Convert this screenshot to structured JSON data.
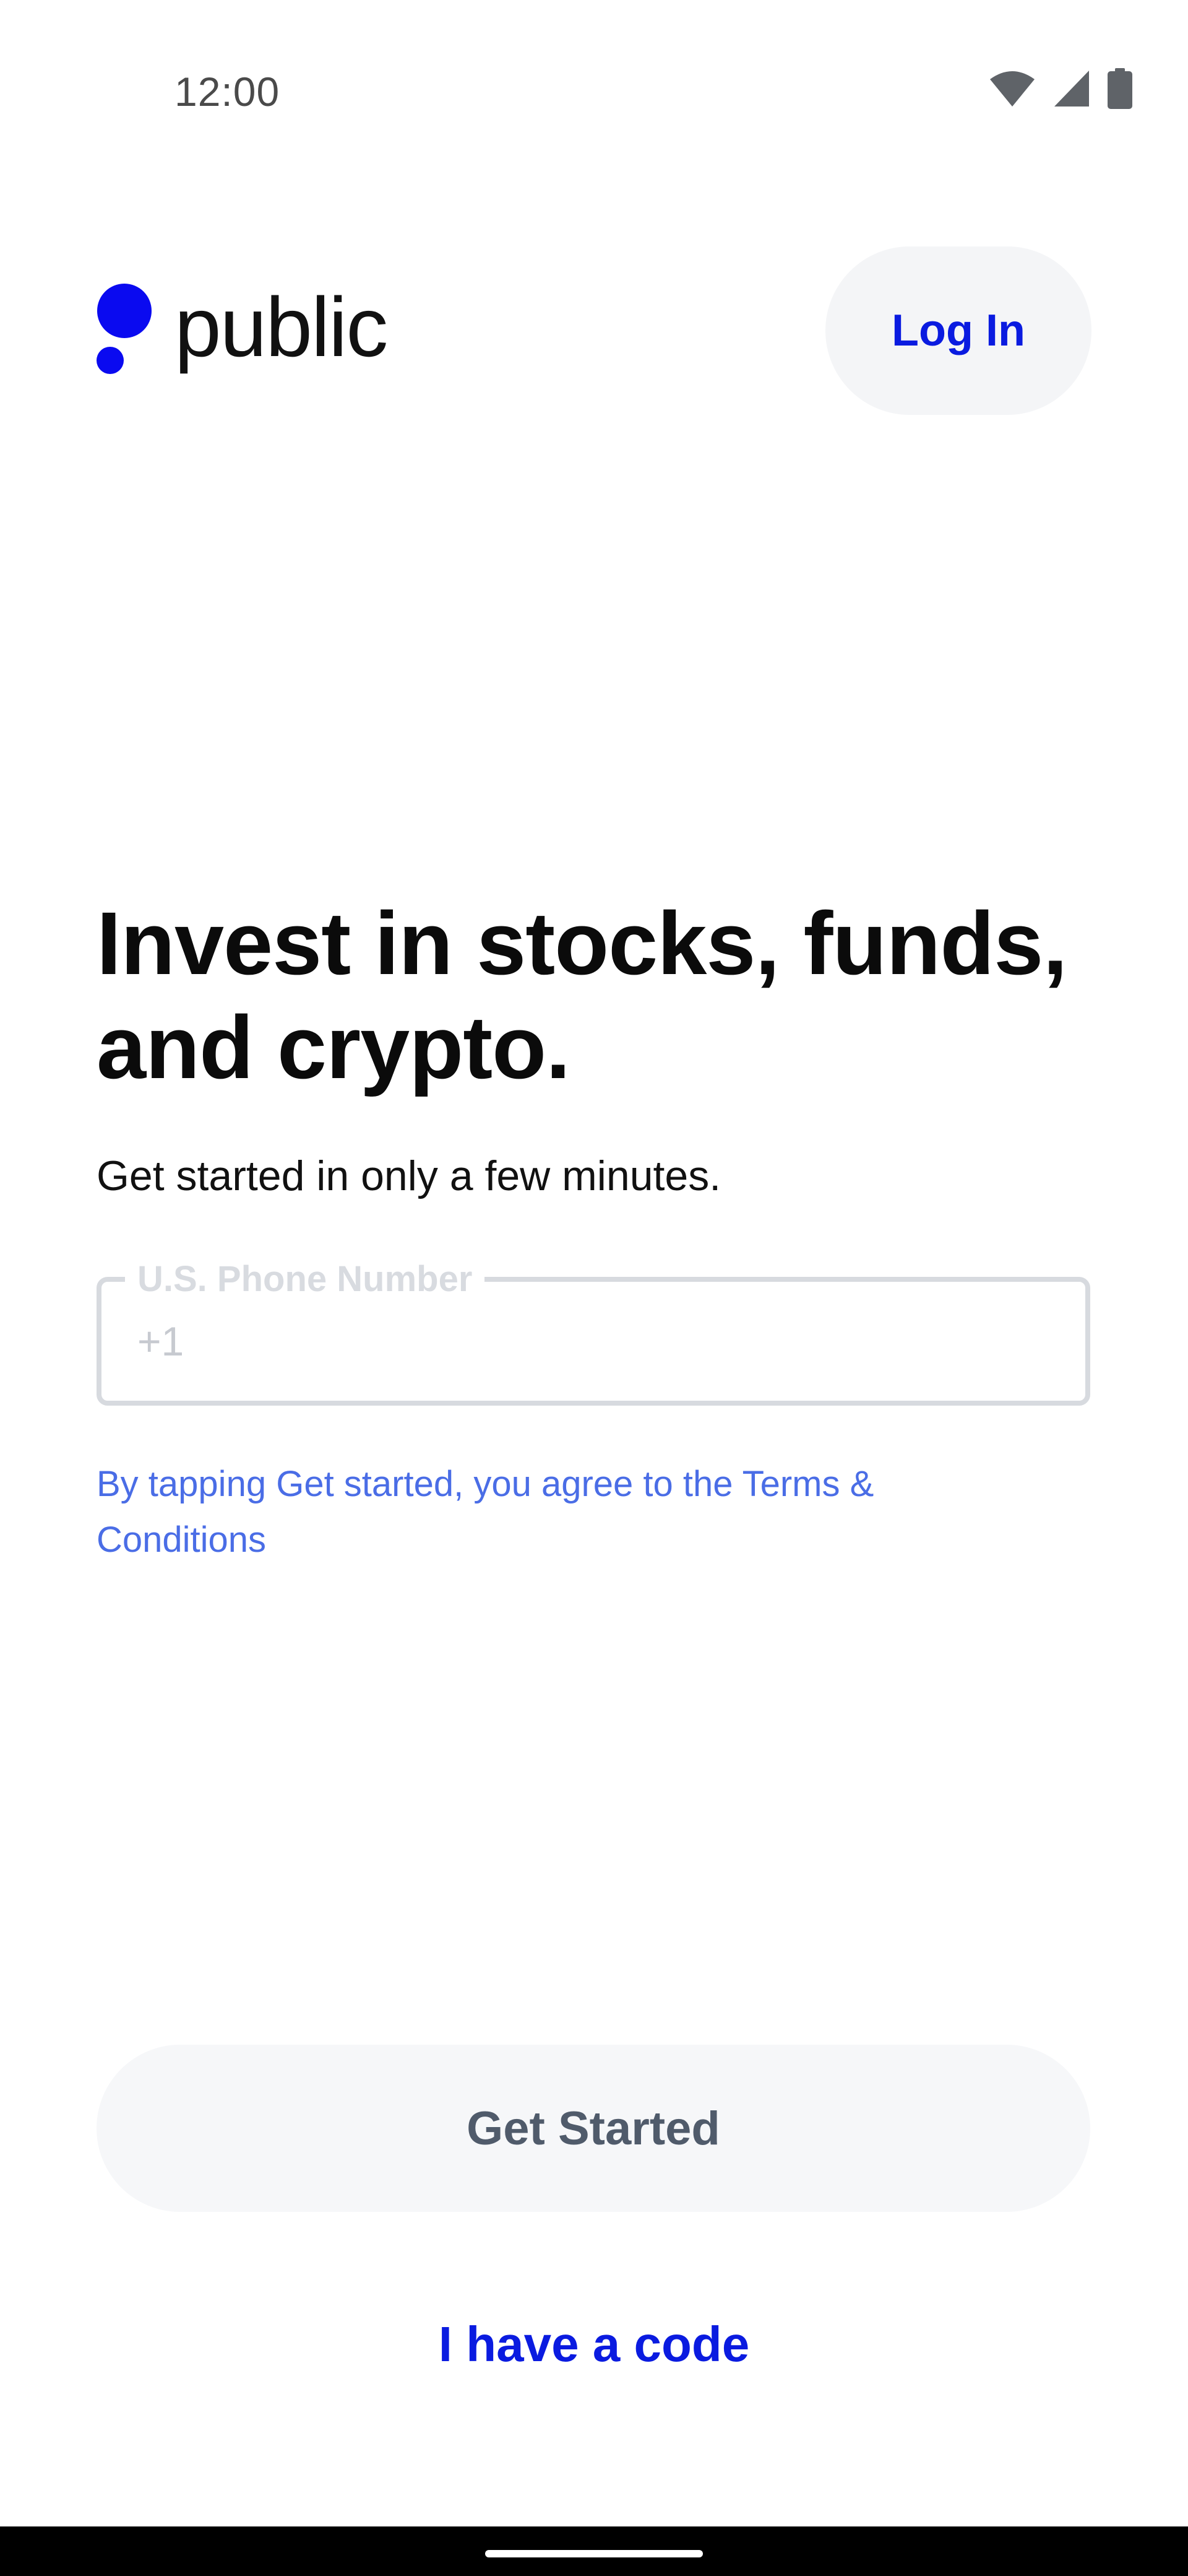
{
  "status_bar": {
    "time": "12:00",
    "icons": [
      "wifi-icon",
      "cell-signal-icon",
      "battery-icon"
    ]
  },
  "header": {
    "brand": "public",
    "login_label": "Log In"
  },
  "main": {
    "headline": "Invest in stocks, funds, and crypto.",
    "subheading": "Get started in only a few minutes.",
    "phone_field": {
      "label": "U.S. Phone Number",
      "prefix": "+1",
      "value": ""
    },
    "terms_prefix": "By tapping Get started, you agree to the ",
    "terms_link": "Terms & Conditions"
  },
  "actions": {
    "get_started_label": "Get Started",
    "code_link_label": "I have a code"
  },
  "colors": {
    "brand_blue": "#0a1be0",
    "link_blue": "#4a6de6",
    "button_bg": "#f4f5f7",
    "disabled_text": "#505b6b"
  }
}
